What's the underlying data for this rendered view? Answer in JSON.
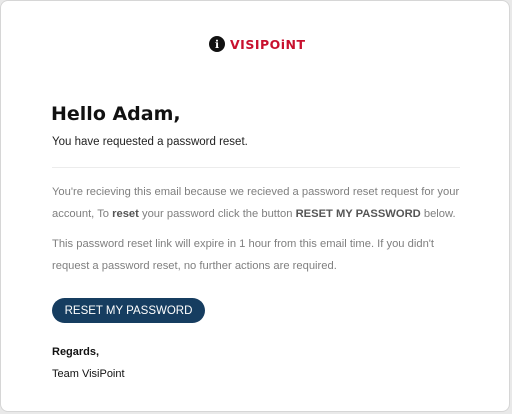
{
  "brand": {
    "name": "VISIPOiNT",
    "mark_glyph": "ℹ",
    "colors": {
      "text": "#c8102e",
      "mark": "#111111"
    }
  },
  "greeting": "Hello Adam,",
  "subline": "You have requested a password reset.",
  "paragraph1": {
    "part1": "You're recieving this email because we recieved a password reset request for your account, To ",
    "bold1": "reset",
    "part2": " your password click the button ",
    "bold2": "RESET MY PASSWORD",
    "part3": " below."
  },
  "paragraph2": "This password reset link will expire in 1 hour from this email time. If you didn't request a password reset, no further actions are required.",
  "button": {
    "label": "RESET MY PASSWORD",
    "color": "#163d60"
  },
  "signoff": {
    "regards": "Regards,",
    "team": "Team VisiPoint"
  }
}
